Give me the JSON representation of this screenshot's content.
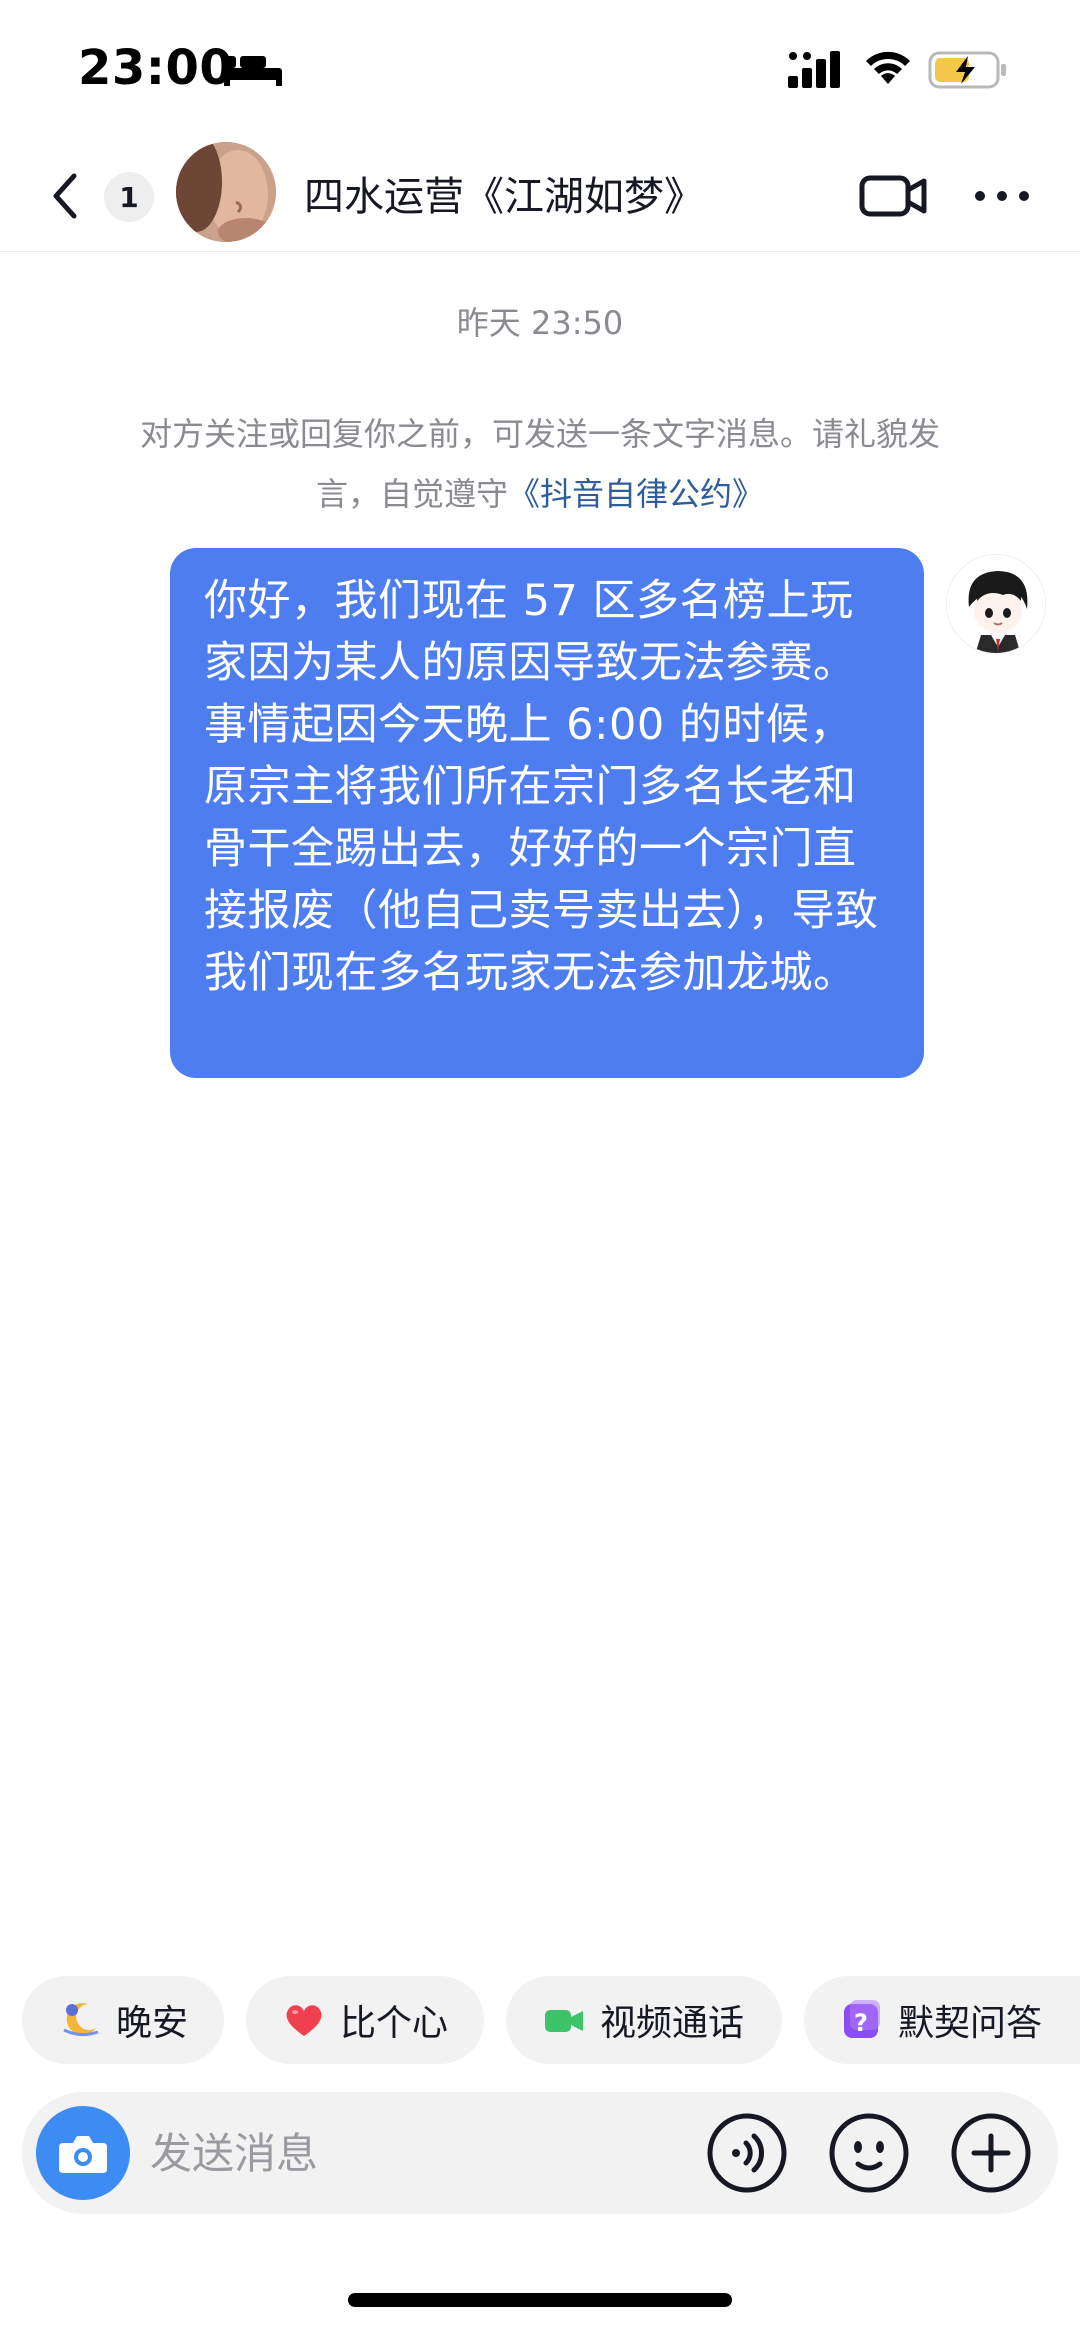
{
  "status_bar": {
    "time": "23:00"
  },
  "header": {
    "unread_count": "1",
    "contact_name": "四水运营《江湖如梦》"
  },
  "chat": {
    "timestamp": "昨天 23:50",
    "notice_text": "对方关注或回复你之前，可发送一条文字消息。请礼貌发言，自觉遵守",
    "notice_link": "《抖音自律公约》",
    "messages": [
      {
        "text": "你好，我们现在 57 区多名榜上玩家因为某人的原因导致无法参赛。事情起因今天晚上 6:00 的时候，原宗主将我们所在宗门多名长老和骨干全踢出去，好好的一个宗门直接报废（他自己卖号卖出去），导致我们现在多名玩家无法参加龙城。"
      }
    ]
  },
  "quick_replies": [
    {
      "label": "晚安",
      "icon": "moon-icon"
    },
    {
      "label": "比个心",
      "icon": "heart-icon"
    },
    {
      "label": "视频通话",
      "icon": "video-camera-icon"
    },
    {
      "label": "默契问答",
      "icon": "question-icon"
    }
  ],
  "input_bar": {
    "placeholder": "发送消息"
  },
  "colors": {
    "bubble": "#4e7df0",
    "camera_button": "#3c8cf4",
    "link": "#2f5d9c",
    "muted_text": "#8a8b91"
  }
}
